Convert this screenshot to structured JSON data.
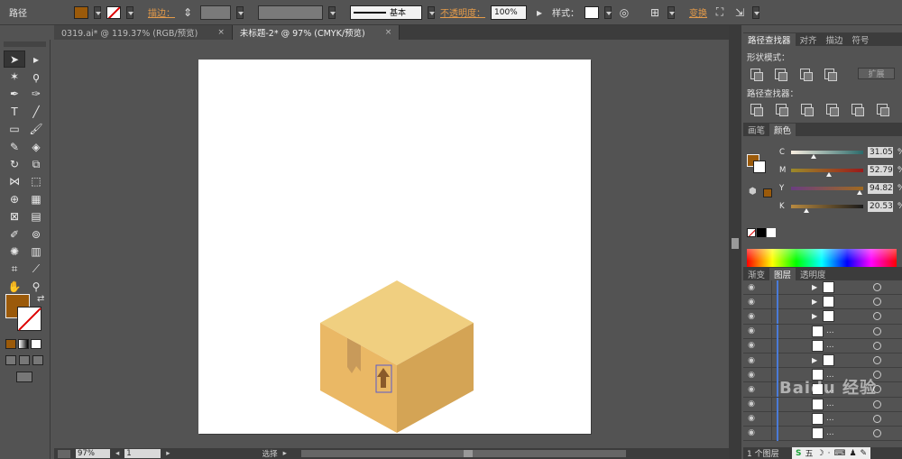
{
  "control_bar": {
    "object_type": "路径",
    "fill_color": "#9b5a0a",
    "stroke_label": "描边：",
    "stroke_profile": "基本",
    "opacity_label": "不透明度：",
    "opacity_value": "100%",
    "style_label": "样式：",
    "transform_label": "变换"
  },
  "tabs": [
    {
      "label": "0319.ai* @ 119.37% (RGB/预览)",
      "active": false
    },
    {
      "label": "未标题-2* @ 97% (CMYK/预览)",
      "active": true
    }
  ],
  "tab_close": "×",
  "status": {
    "zoom": "97%",
    "page": "1",
    "tool": "选择"
  },
  "pathfinder_panel": {
    "tabs": [
      "路径查找器",
      "对齐",
      "描边",
      "符号"
    ],
    "shape_modes_label": "形状模式：",
    "expand_label": "扩展",
    "pathfinders_label": "路径查找器："
  },
  "color_panel": {
    "tabs": [
      "画笔",
      "颜色"
    ],
    "channels": [
      {
        "name": "C",
        "value": "31.05",
        "fraction": 0.31,
        "gradient": [
          "#f7ede0",
          "#2b6a6a"
        ]
      },
      {
        "name": "M",
        "value": "52.79",
        "fraction": 0.53,
        "gradient": [
          "#9b8a2a",
          "#9b1a1a"
        ]
      },
      {
        "name": "Y",
        "value": "94.82",
        "fraction": 0.95,
        "gradient": [
          "#6a3e80",
          "#a06a20"
        ]
      },
      {
        "name": "K",
        "value": "20.53",
        "fraction": 0.21,
        "gradient": [
          "#b88a40",
          "#1a1a1a"
        ]
      }
    ],
    "percent": "%"
  },
  "layers_panel": {
    "tabs": [
      "渐变",
      "图层",
      "透明度"
    ],
    "row_dots": "...",
    "footer_text": "1 个图层",
    "ime": [
      "S",
      "五",
      "☽",
      "·",
      "⌨",
      "♟",
      "✎"
    ]
  },
  "watermark": "Baidu 经验",
  "colors": {
    "box_top": "#f0cf80",
    "box_left": "#eab865",
    "box_right": "#d4a455",
    "tape": "#c89a5a",
    "arrow": "#8a5a2a",
    "selection": "#5a5acc"
  }
}
